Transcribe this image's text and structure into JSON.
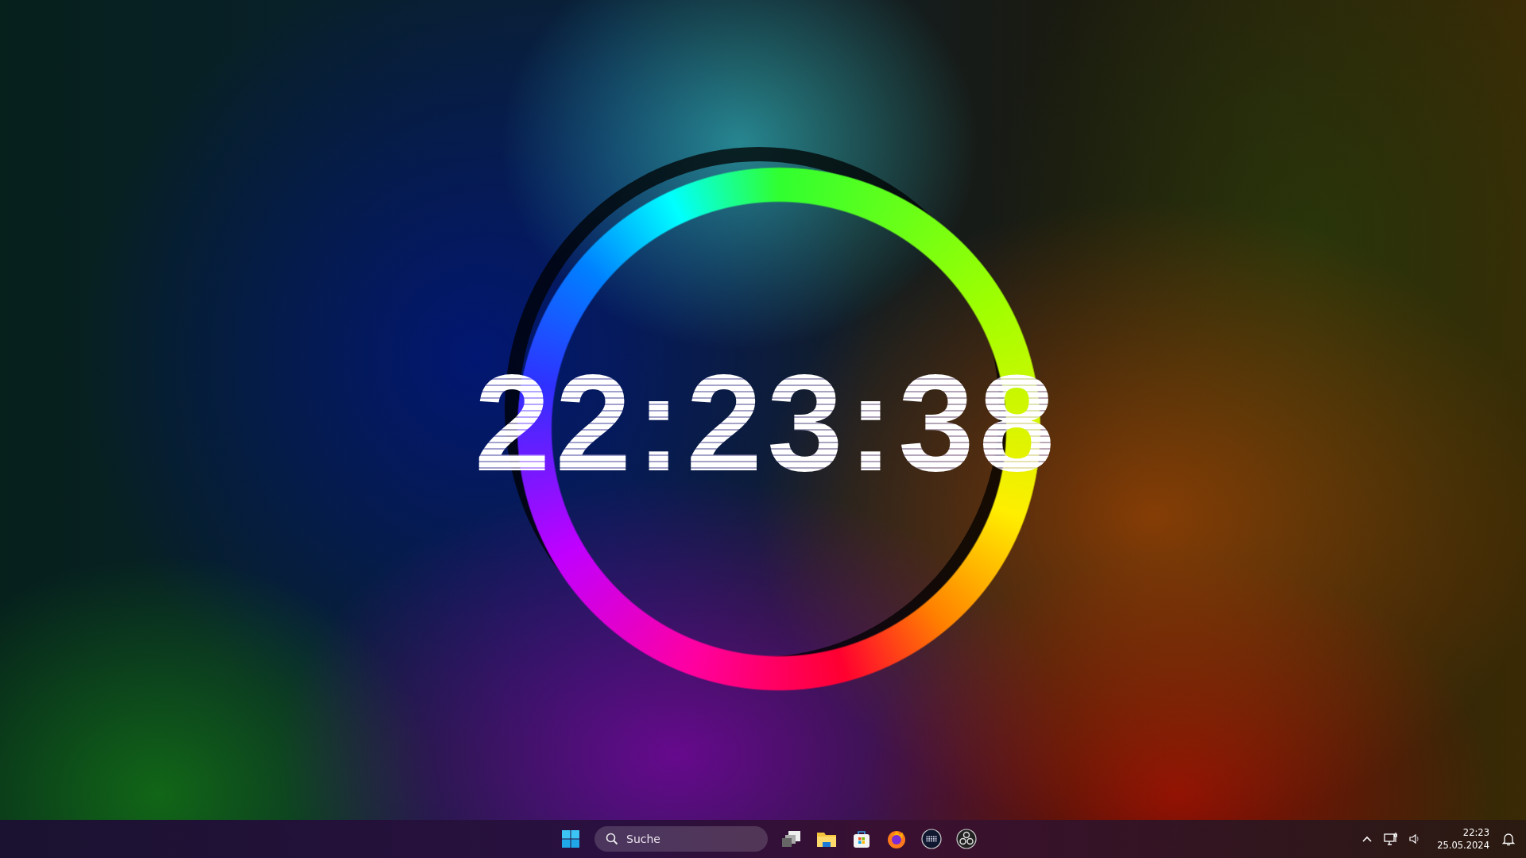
{
  "desktop": {
    "wallpaper_clock": "22:23:38"
  },
  "taskbar": {
    "search": {
      "placeholder": "Suche"
    },
    "tray": {
      "time": "22:23",
      "date": "25.05.2024"
    }
  }
}
